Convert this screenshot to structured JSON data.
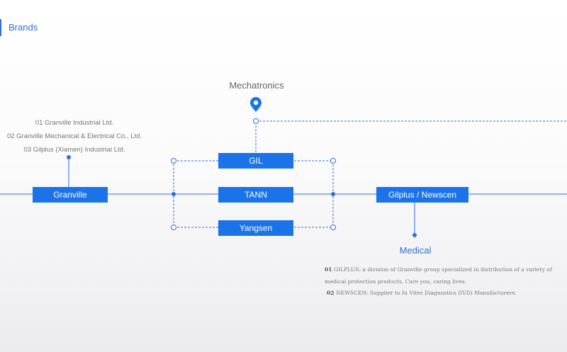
{
  "page": {
    "heading": "Brands"
  },
  "diagram": {
    "nodes": {
      "granville": "Granville",
      "gil": "GIL",
      "tann": "TANN",
      "yangsen": "Yangsen",
      "gilplus": "Gilplus / Newscen"
    },
    "labels": {
      "mechatronics": "Mechatronics",
      "medical": "Medical"
    },
    "granville_companies": [
      "01 Granville Industrial Ltd.",
      "02 Granville Mechanical & Electrical Co., Ltd.",
      "03 Gilplus (Xiamen) Industrial Ltd."
    ],
    "medical_notes": [
      {
        "num": "01",
        "text": "GILPLUS: a division of Granville group specialized in distribution of a variety of medical protection products. Care you, caring lives."
      },
      {
        "num": "02",
        "text": "NEWSCEN: Supplier to In Vitro Diagnostics (IVD) Manufacturers."
      }
    ],
    "colors": {
      "accent": "#1a73e8",
      "line": "#2f6fd6",
      "text": "#666666"
    },
    "icons": [
      "location-pin-icon"
    ]
  }
}
